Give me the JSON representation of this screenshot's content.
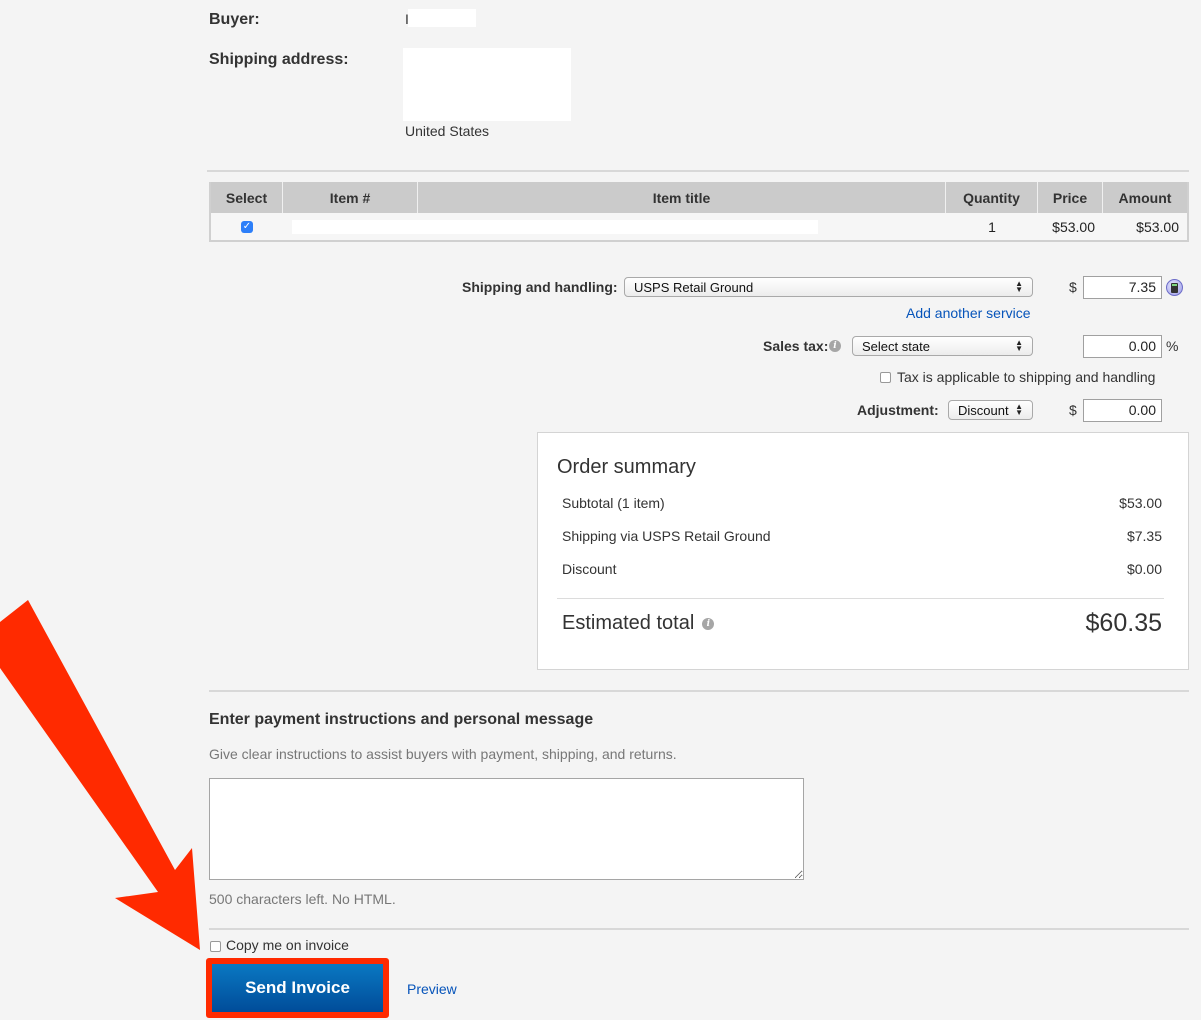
{
  "buyer": {
    "label": "Buyer:",
    "value": "I"
  },
  "shipping_address": {
    "label": "Shipping address:",
    "country": "United States"
  },
  "items_table": {
    "headers": [
      "Select",
      "Item #",
      "Item title",
      "Quantity",
      "Price",
      "Amount"
    ],
    "rows": [
      {
        "selected": true,
        "item_number": "",
        "title": "",
        "quantity": "1",
        "price": "$53.00",
        "amount": "$53.00"
      }
    ]
  },
  "shipping": {
    "label": "Shipping and handling:",
    "service": "USPS Retail Ground",
    "currency": "$",
    "cost": "7.35",
    "add_service_link": "Add another service",
    "calculator_icon": "calculator-icon"
  },
  "sales_tax": {
    "label": "Sales tax:",
    "state_select": "Select state",
    "rate": "0.00",
    "percent": "%",
    "apply_to_shipping_label": "Tax is applicable to shipping and handling",
    "apply_to_shipping_checked": false
  },
  "adjustment": {
    "label": "Adjustment:",
    "type": "Discount",
    "currency": "$",
    "value": "0.00"
  },
  "order_summary": {
    "title": "Order summary",
    "lines": [
      {
        "label": "Subtotal (1 item)",
        "value": "$53.00"
      },
      {
        "label": "Shipping via USPS Retail Ground",
        "value": "$7.35"
      },
      {
        "label": "Discount",
        "value": "$0.00"
      }
    ],
    "total_label": "Estimated total",
    "total_value": "$60.35"
  },
  "message": {
    "heading": "Enter payment instructions and personal message",
    "hint": "Give clear instructions to assist buyers with payment, shipping, and returns.",
    "value": "",
    "chars_left": "500 characters left. No HTML."
  },
  "footer": {
    "copy_me_label": "Copy me on invoice",
    "copy_me_checked": false,
    "send_button": "Send Invoice",
    "preview_link": "Preview"
  },
  "colors": {
    "annotation_red": "#ff2a00",
    "button_blue": "#0a62ad",
    "link_blue": "#0654ba"
  }
}
